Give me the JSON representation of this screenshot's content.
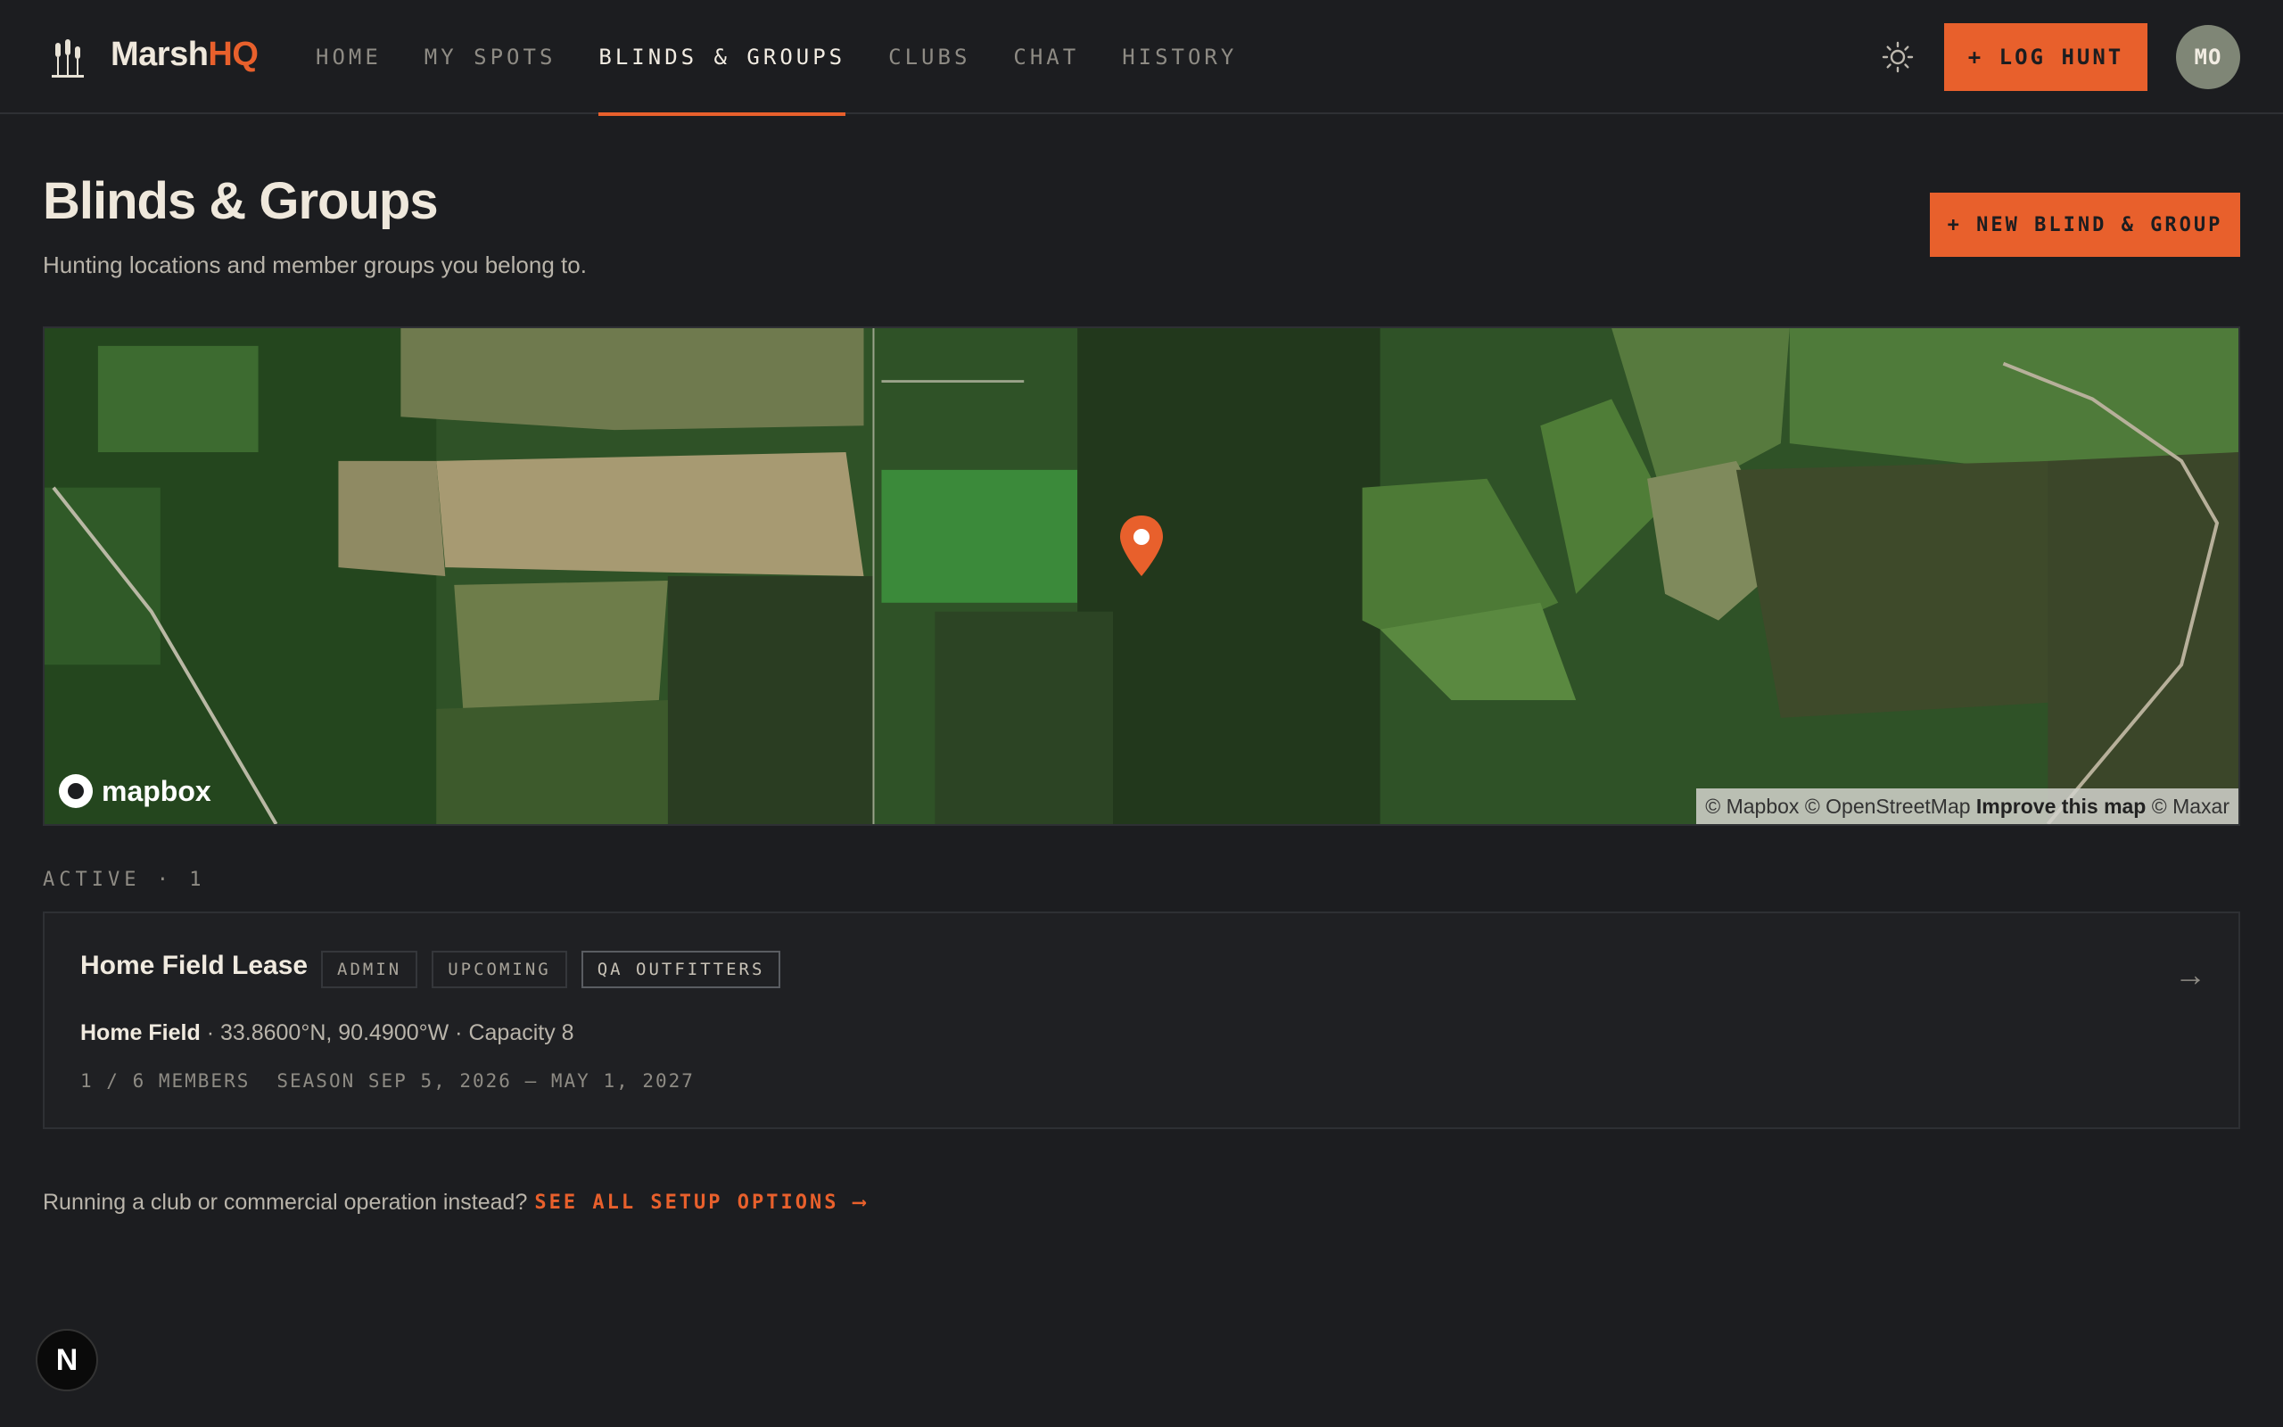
{
  "app": {
    "name_main": "Marsh",
    "name_accent": "HQ"
  },
  "nav": {
    "tabs": [
      {
        "label": "HOME"
      },
      {
        "label": "MY SPOTS"
      },
      {
        "label": "BLINDS & GROUPS",
        "active": true
      },
      {
        "label": "CLUBS"
      },
      {
        "label": "CHAT"
      },
      {
        "label": "HISTORY"
      }
    ],
    "log_hunt_label": "+ LOG HUNT",
    "avatar_initials": "MO"
  },
  "header": {
    "title": "Blinds & Groups",
    "subtitle": "Hunting locations and member groups you belong to.",
    "new_button_label": "+ NEW BLIND & GROUP"
  },
  "map": {
    "logo_text": "mapbox",
    "attribution": {
      "part1": "© Mapbox © OpenStreetMap ",
      "improve": "Improve this map",
      "part2": " © Maxar"
    }
  },
  "active_section": {
    "label": "ACTIVE · 1"
  },
  "blinds": [
    {
      "title": "Home Field Lease",
      "badges": [
        "ADMIN",
        "UPCOMING",
        "QA OUTFITTERS"
      ],
      "location_name": "Home Field",
      "location_detail": " · 33.8600°N, 90.4900°W · Capacity 8",
      "members": "1 / 6 MEMBERS",
      "season": "SEASON SEP 5, 2026 – MAY 1, 2027",
      "arrow": "→"
    }
  ],
  "footer": {
    "text": "Running a club or commercial operation instead?",
    "link_label": "SEE ALL SETUP OPTIONS ⟶"
  },
  "dev_badge": "N",
  "colors": {
    "accent": "#e8602c",
    "background": "#1c1d20",
    "card_bg": "#1f2023",
    "border": "#2e3034"
  }
}
